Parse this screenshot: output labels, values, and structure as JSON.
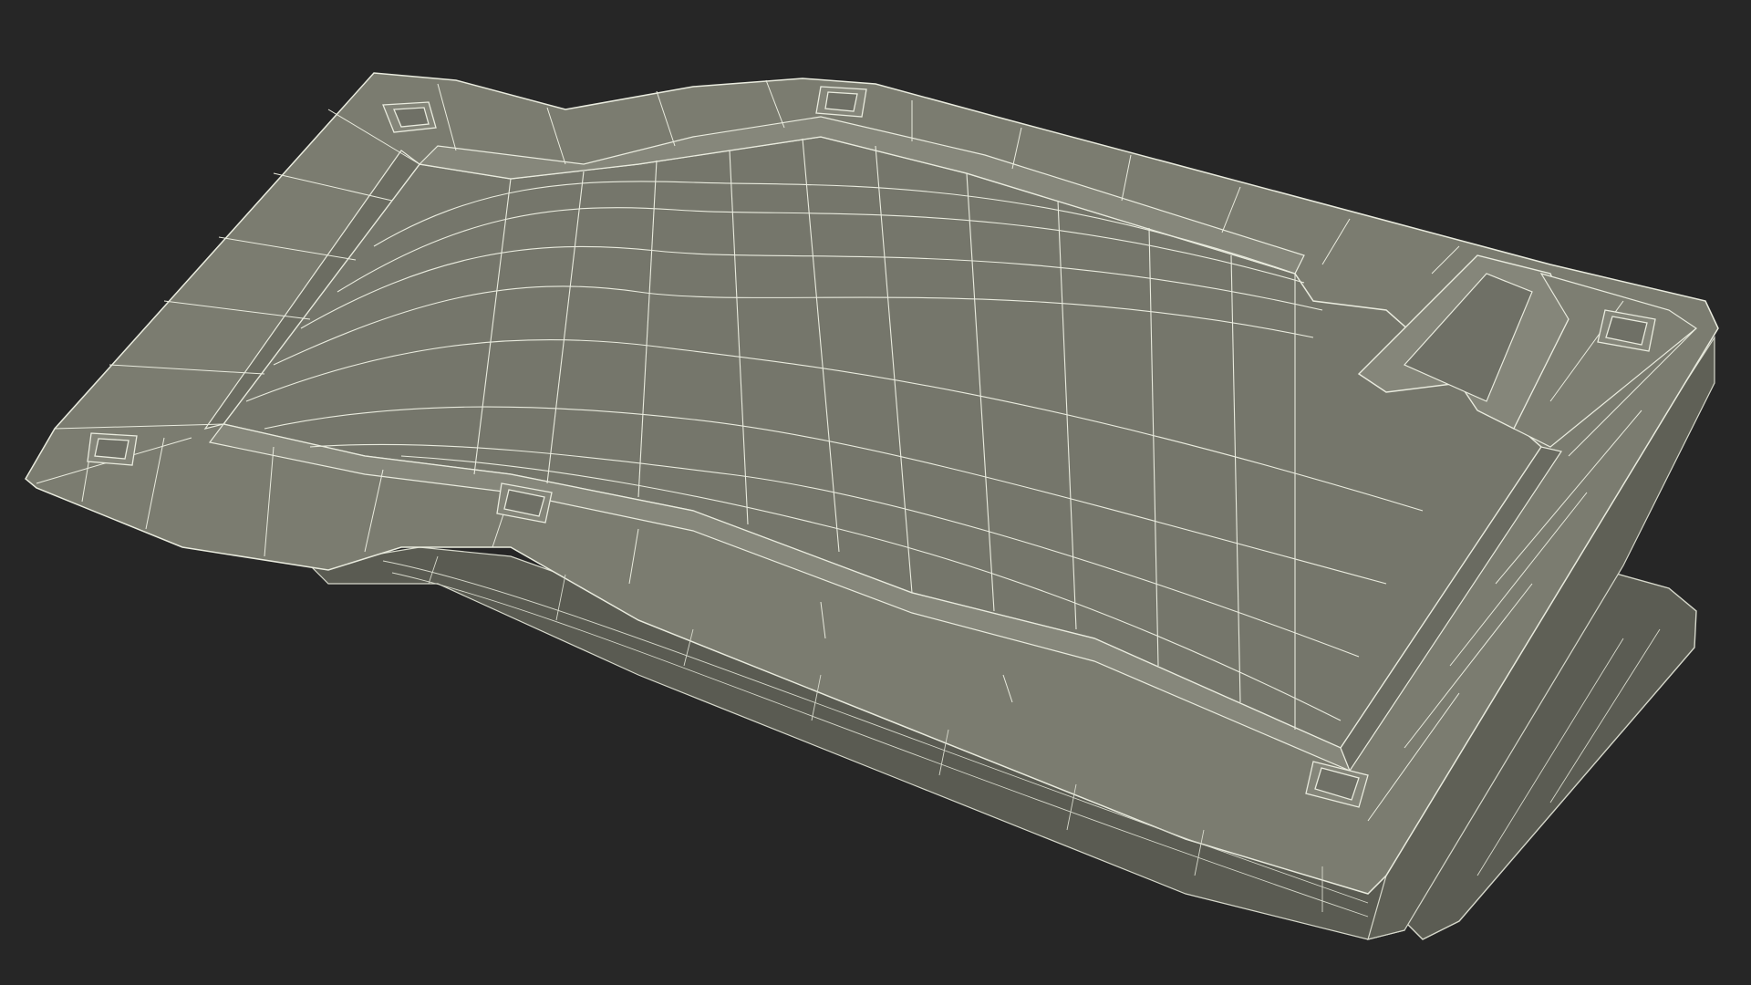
{
  "scene": {
    "subject": "wireframe-tray-model",
    "colors": {
      "background": "#262626",
      "surface": "#7b7c70",
      "surface_dark": "#64655b",
      "surface_light": "#8b8c80",
      "side": "#5b5c53",
      "wire": "#e9ebde",
      "wire_soft": "#c9cbbe"
    }
  }
}
